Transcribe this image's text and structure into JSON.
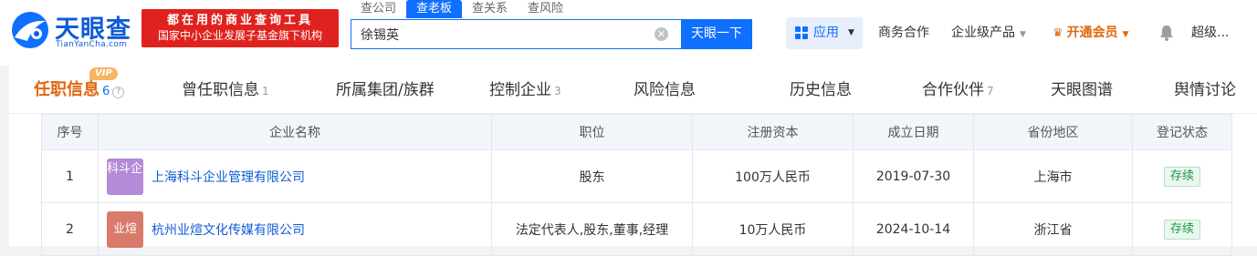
{
  "header": {
    "brand": "天眼查",
    "brand_en": "TianYanCha.com",
    "slogan_line1": "都在用的商业查询工具",
    "slogan_line2": "国家中小企业发展子基金旗下机构",
    "search_tabs": [
      "查公司",
      "查老板",
      "查关系",
      "查风险"
    ],
    "active_search_tab": "查老板",
    "search_value": "徐锡英",
    "search_button": "天眼一下",
    "apps_label": "应用",
    "nav": {
      "business": "商务合作",
      "enterprise": "企业级产品",
      "vip": "开通会员",
      "user": "超级..."
    },
    "colors": {
      "accent": "#0f6fff",
      "brand": "#0f5bd6",
      "slogan_bg": "#e0221f",
      "vip": "#e1660e"
    }
  },
  "tabs": [
    {
      "label": "任职信息",
      "count": "6",
      "active": true,
      "badge": "VIP"
    },
    {
      "label": "曾任职信息",
      "count": "1"
    },
    {
      "label": "所属集团/族群",
      "count": ""
    },
    {
      "label": "控制企业",
      "count": "3"
    },
    {
      "label": "风险信息",
      "count": ""
    },
    {
      "label": "历史信息",
      "count": ""
    },
    {
      "label": "合作伙伴",
      "count": "7"
    },
    {
      "label": "天眼图谱",
      "count": ""
    },
    {
      "label": "舆情讨论",
      "count": ""
    }
  ],
  "table": {
    "columns": [
      "序号",
      "企业名称",
      "职位",
      "注册资本",
      "成立日期",
      "省份地区",
      "登记状态"
    ],
    "rows": [
      {
        "index": "1",
        "logo_text": "科斗企业",
        "logo_color": "#b58ad6",
        "company": "上海科斗企业管理有限公司",
        "position": "股东",
        "capital": "100万人民币",
        "founded": "2019-07-30",
        "region": "上海市",
        "status": "存续"
      },
      {
        "index": "2",
        "logo_text": "业煊",
        "logo_color": "#d97a6a",
        "company": "杭州业煊文化传媒有限公司",
        "position": "法定代表人,股东,董事,经理",
        "capital": "10万人民币",
        "founded": "2024-10-14",
        "region": "浙江省",
        "status": "存续"
      }
    ]
  }
}
